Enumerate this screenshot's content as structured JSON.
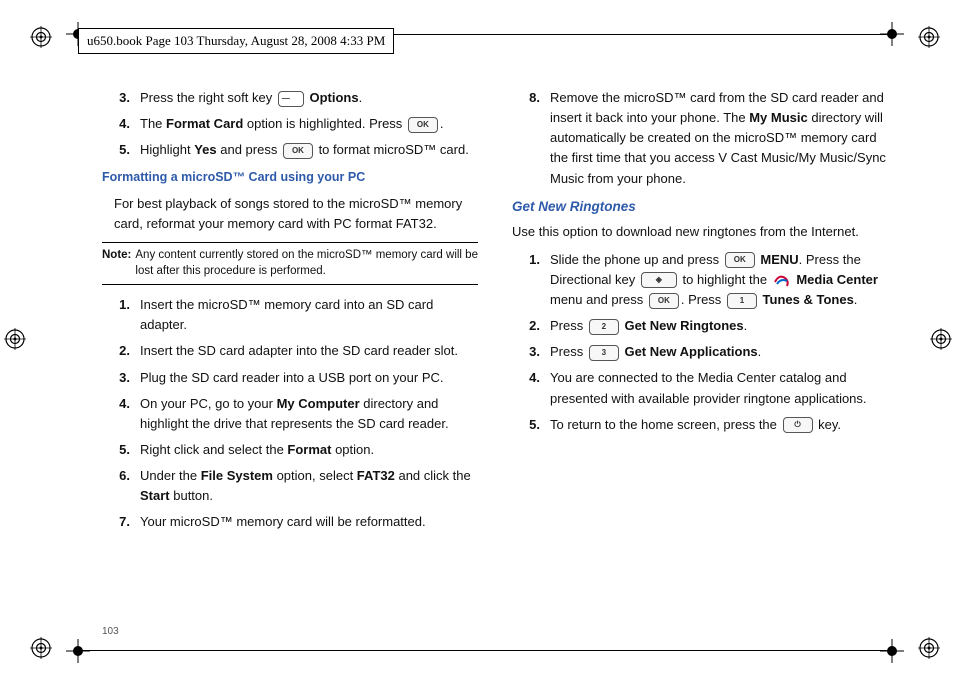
{
  "header": "u650.book  Page 103  Thursday, August 28, 2008  4:33 PM",
  "page_number": "103",
  "col1": {
    "top_steps": [
      {
        "n": "3.",
        "pre": "Press the right soft key ",
        "post": " ",
        "bold": "Options",
        "end": "."
      },
      {
        "n": "4.",
        "pre": "The ",
        "bold": "Format Card",
        "mid": " option is highlighted. Press ",
        "end": "."
      },
      {
        "n": "5.",
        "pre": "Highlight ",
        "bold": "Yes",
        "mid": " and press ",
        "post": " to format microSD™ card."
      }
    ],
    "subhead": "Formatting a microSD™ Card using your PC",
    "para": "For best playback of songs stored to the microSD™ memory card, reformat your memory card with PC format FAT32.",
    "note_label": "Note:",
    "note_body": "Any content currently stored on the microSD™ memory card will be lost after this procedure is performed.",
    "steps": [
      {
        "n": "1.",
        "text": "Insert the microSD™ memory card into an SD card adapter."
      },
      {
        "n": "2.",
        "text": "Insert the SD card adapter into the SD card reader slot."
      },
      {
        "n": "3.",
        "text": "Plug the SD card reader into a USB port on your PC."
      },
      {
        "n": "4.",
        "pre": "On your PC, go to your ",
        "bold": "My Computer",
        "post": " directory and highlight the drive that represents the SD card reader."
      },
      {
        "n": "5.",
        "pre": "Right click and select the ",
        "bold": "Format",
        "post": " option."
      },
      {
        "n": "6.",
        "pre": "Under the ",
        "bold": "File System",
        "mid": " option, select ",
        "bold2": "FAT32",
        "mid2": " and click the ",
        "bold3": "Start",
        "post": " button."
      },
      {
        "n": "7.",
        "text": "Your microSD™ memory card will be reformatted."
      }
    ]
  },
  "col2": {
    "top_steps": [
      {
        "n": "8.",
        "pre": "Remove the microSD™ card from the SD card reader and insert it back into your phone. The ",
        "bold": "My Music",
        "post": " directory will automatically be created on the microSD™ memory card the first time that you access V Cast Music/My Music/Sync Music from your phone."
      }
    ],
    "subhead": "Get New Ringtones",
    "para": "Use this option to download new ringtones from the Internet.",
    "steps": {
      "s1": {
        "n": "1.",
        "a": "Slide the phone up and press ",
        "b": " ",
        "menu": "MENU",
        "c": ". Press the Directional key ",
        "d": " to highlight the ",
        "mc": "Media Center",
        "e": " menu and press ",
        "f": ". Press ",
        "tt": "Tunes & Tones",
        "g": "."
      },
      "s2": {
        "n": "2.",
        "a": "Press ",
        "bold": "Get New Ringtones",
        "b": "."
      },
      "s3": {
        "n": "3.",
        "a": "Press ",
        "bold": "Get New Applications",
        "b": "."
      },
      "s4": {
        "n": "4.",
        "text": "You are connected to the Media Center catalog and presented with available provider ringtone applications."
      },
      "s5": {
        "n": "5.",
        "a": "To return to the home screen, press the ",
        "b": " key."
      }
    }
  },
  "keys": {
    "ok": "OK",
    "one": "1",
    "two": "2",
    "three": "3"
  }
}
